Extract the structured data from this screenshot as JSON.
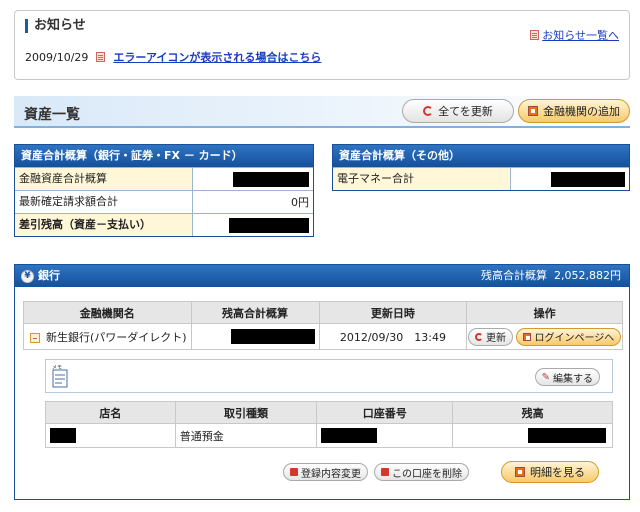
{
  "notice": {
    "title": "お知らせ",
    "more_link": "お知らせ一覧へ",
    "date": "2009/10/29",
    "link": "エラーアイコンが表示される場合はこちら"
  },
  "assets": {
    "title": "資産一覧",
    "refresh_all": "全てを更新",
    "add_institution": "金融機関の追加"
  },
  "summary_left": {
    "header": "資産合計概算（銀行・証券・FX － カード）",
    "rows": [
      {
        "label": "金融資産合計概算",
        "value": ""
      },
      {
        "label": "最新確定請求額合計",
        "value": "0円"
      },
      {
        "label": "差引残高（資産－支払い）",
        "value": ""
      }
    ]
  },
  "summary_right": {
    "header": "資産合計概算（その他）",
    "rows": [
      {
        "label": "電子マネー合計",
        "value": ""
      }
    ]
  },
  "bank": {
    "header": "銀行",
    "total_label": "残高合計概算",
    "total_value": "2,052,882円",
    "columns": [
      "金融機関名",
      "残高合計概算",
      "更新日時",
      "操作"
    ],
    "row": {
      "name": "新生銀行(パワーダイレクト)",
      "updated": "2012/09/30　13:49",
      "update_btn": "更新",
      "login_btn": "ログインページへ"
    },
    "memo_icon_label": "メモ",
    "edit_btn": "編集する",
    "acct_columns": [
      "店名",
      "取引種類",
      "口座番号",
      "残高"
    ],
    "acct_row": {
      "type": "普通預金"
    },
    "change_btn": "登録内容変更",
    "delete_btn": "この口座を削除",
    "detail_btn": "明細を見る"
  },
  "colors": {
    "accent_blue": "#1a4f99",
    "link": "#1a3cc0",
    "orange": "#f7c96b"
  }
}
